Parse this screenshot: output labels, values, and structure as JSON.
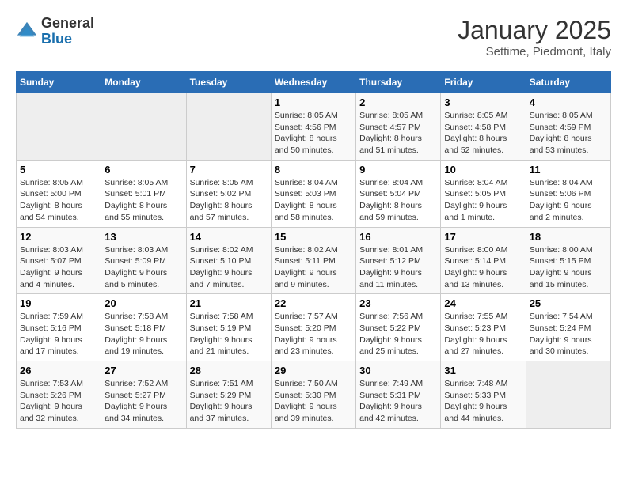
{
  "header": {
    "logo": {
      "line1": "General",
      "line2": "Blue"
    },
    "title": "January 2025",
    "subtitle": "Settime, Piedmont, Italy"
  },
  "weekdays": [
    "Sunday",
    "Monday",
    "Tuesday",
    "Wednesday",
    "Thursday",
    "Friday",
    "Saturday"
  ],
  "weeks": [
    [
      {
        "day": null
      },
      {
        "day": null
      },
      {
        "day": null
      },
      {
        "day": "1",
        "sunrise": "Sunrise: 8:05 AM",
        "sunset": "Sunset: 4:56 PM",
        "daylight": "Daylight: 8 hours and 50 minutes."
      },
      {
        "day": "2",
        "sunrise": "Sunrise: 8:05 AM",
        "sunset": "Sunset: 4:57 PM",
        "daylight": "Daylight: 8 hours and 51 minutes."
      },
      {
        "day": "3",
        "sunrise": "Sunrise: 8:05 AM",
        "sunset": "Sunset: 4:58 PM",
        "daylight": "Daylight: 8 hours and 52 minutes."
      },
      {
        "day": "4",
        "sunrise": "Sunrise: 8:05 AM",
        "sunset": "Sunset: 4:59 PM",
        "daylight": "Daylight: 8 hours and 53 minutes."
      }
    ],
    [
      {
        "day": "5",
        "sunrise": "Sunrise: 8:05 AM",
        "sunset": "Sunset: 5:00 PM",
        "daylight": "Daylight: 8 hours and 54 minutes."
      },
      {
        "day": "6",
        "sunrise": "Sunrise: 8:05 AM",
        "sunset": "Sunset: 5:01 PM",
        "daylight": "Daylight: 8 hours and 55 minutes."
      },
      {
        "day": "7",
        "sunrise": "Sunrise: 8:05 AM",
        "sunset": "Sunset: 5:02 PM",
        "daylight": "Daylight: 8 hours and 57 minutes."
      },
      {
        "day": "8",
        "sunrise": "Sunrise: 8:04 AM",
        "sunset": "Sunset: 5:03 PM",
        "daylight": "Daylight: 8 hours and 58 minutes."
      },
      {
        "day": "9",
        "sunrise": "Sunrise: 8:04 AM",
        "sunset": "Sunset: 5:04 PM",
        "daylight": "Daylight: 8 hours and 59 minutes."
      },
      {
        "day": "10",
        "sunrise": "Sunrise: 8:04 AM",
        "sunset": "Sunset: 5:05 PM",
        "daylight": "Daylight: 9 hours and 1 minute."
      },
      {
        "day": "11",
        "sunrise": "Sunrise: 8:04 AM",
        "sunset": "Sunset: 5:06 PM",
        "daylight": "Daylight: 9 hours and 2 minutes."
      }
    ],
    [
      {
        "day": "12",
        "sunrise": "Sunrise: 8:03 AM",
        "sunset": "Sunset: 5:07 PM",
        "daylight": "Daylight: 9 hours and 4 minutes."
      },
      {
        "day": "13",
        "sunrise": "Sunrise: 8:03 AM",
        "sunset": "Sunset: 5:09 PM",
        "daylight": "Daylight: 9 hours and 5 minutes."
      },
      {
        "day": "14",
        "sunrise": "Sunrise: 8:02 AM",
        "sunset": "Sunset: 5:10 PM",
        "daylight": "Daylight: 9 hours and 7 minutes."
      },
      {
        "day": "15",
        "sunrise": "Sunrise: 8:02 AM",
        "sunset": "Sunset: 5:11 PM",
        "daylight": "Daylight: 9 hours and 9 minutes."
      },
      {
        "day": "16",
        "sunrise": "Sunrise: 8:01 AM",
        "sunset": "Sunset: 5:12 PM",
        "daylight": "Daylight: 9 hours and 11 minutes."
      },
      {
        "day": "17",
        "sunrise": "Sunrise: 8:00 AM",
        "sunset": "Sunset: 5:14 PM",
        "daylight": "Daylight: 9 hours and 13 minutes."
      },
      {
        "day": "18",
        "sunrise": "Sunrise: 8:00 AM",
        "sunset": "Sunset: 5:15 PM",
        "daylight": "Daylight: 9 hours and 15 minutes."
      }
    ],
    [
      {
        "day": "19",
        "sunrise": "Sunrise: 7:59 AM",
        "sunset": "Sunset: 5:16 PM",
        "daylight": "Daylight: 9 hours and 17 minutes."
      },
      {
        "day": "20",
        "sunrise": "Sunrise: 7:58 AM",
        "sunset": "Sunset: 5:18 PM",
        "daylight": "Daylight: 9 hours and 19 minutes."
      },
      {
        "day": "21",
        "sunrise": "Sunrise: 7:58 AM",
        "sunset": "Sunset: 5:19 PM",
        "daylight": "Daylight: 9 hours and 21 minutes."
      },
      {
        "day": "22",
        "sunrise": "Sunrise: 7:57 AM",
        "sunset": "Sunset: 5:20 PM",
        "daylight": "Daylight: 9 hours and 23 minutes."
      },
      {
        "day": "23",
        "sunrise": "Sunrise: 7:56 AM",
        "sunset": "Sunset: 5:22 PM",
        "daylight": "Daylight: 9 hours and 25 minutes."
      },
      {
        "day": "24",
        "sunrise": "Sunrise: 7:55 AM",
        "sunset": "Sunset: 5:23 PM",
        "daylight": "Daylight: 9 hours and 27 minutes."
      },
      {
        "day": "25",
        "sunrise": "Sunrise: 7:54 AM",
        "sunset": "Sunset: 5:24 PM",
        "daylight": "Daylight: 9 hours and 30 minutes."
      }
    ],
    [
      {
        "day": "26",
        "sunrise": "Sunrise: 7:53 AM",
        "sunset": "Sunset: 5:26 PM",
        "daylight": "Daylight: 9 hours and 32 minutes."
      },
      {
        "day": "27",
        "sunrise": "Sunrise: 7:52 AM",
        "sunset": "Sunset: 5:27 PM",
        "daylight": "Daylight: 9 hours and 34 minutes."
      },
      {
        "day": "28",
        "sunrise": "Sunrise: 7:51 AM",
        "sunset": "Sunset: 5:29 PM",
        "daylight": "Daylight: 9 hours and 37 minutes."
      },
      {
        "day": "29",
        "sunrise": "Sunrise: 7:50 AM",
        "sunset": "Sunset: 5:30 PM",
        "daylight": "Daylight: 9 hours and 39 minutes."
      },
      {
        "day": "30",
        "sunrise": "Sunrise: 7:49 AM",
        "sunset": "Sunset: 5:31 PM",
        "daylight": "Daylight: 9 hours and 42 minutes."
      },
      {
        "day": "31",
        "sunrise": "Sunrise: 7:48 AM",
        "sunset": "Sunset: 5:33 PM",
        "daylight": "Daylight: 9 hours and 44 minutes."
      },
      {
        "day": null
      }
    ]
  ]
}
